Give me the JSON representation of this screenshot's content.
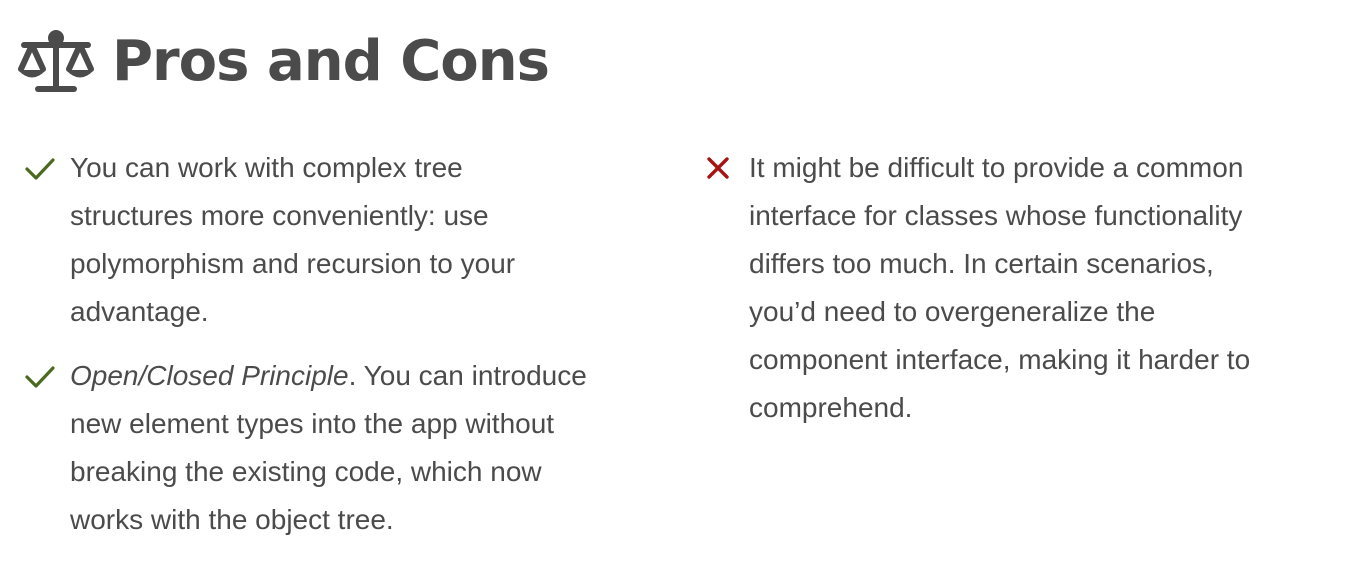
{
  "section": {
    "title": "Pros and Cons",
    "icon": "balance-scale-icon"
  },
  "pros": {
    "icon": "check-icon",
    "color": "#4a6b1e",
    "items": [
      {
        "text": "You can work with complex tree\nstructures more conveniently: use\npolymorphism and recursion to your\nadvantage."
      },
      {
        "emphasis": "Open/Closed Principle",
        "text": ". You can introduce\nnew element types into the app without\nbreaking the existing code, which now\nworks with the object tree."
      }
    ]
  },
  "cons": {
    "icon": "cross-icon",
    "color": "#a31515",
    "items": [
      {
        "text": "It might be difficult to provide a common\ninterface for classes whose functionality\ndiffers too much. In certain scenarios,\nyou’d need to overgeneralize the\ncomponent interface, making it harder to\ncomprehend."
      }
    ]
  }
}
